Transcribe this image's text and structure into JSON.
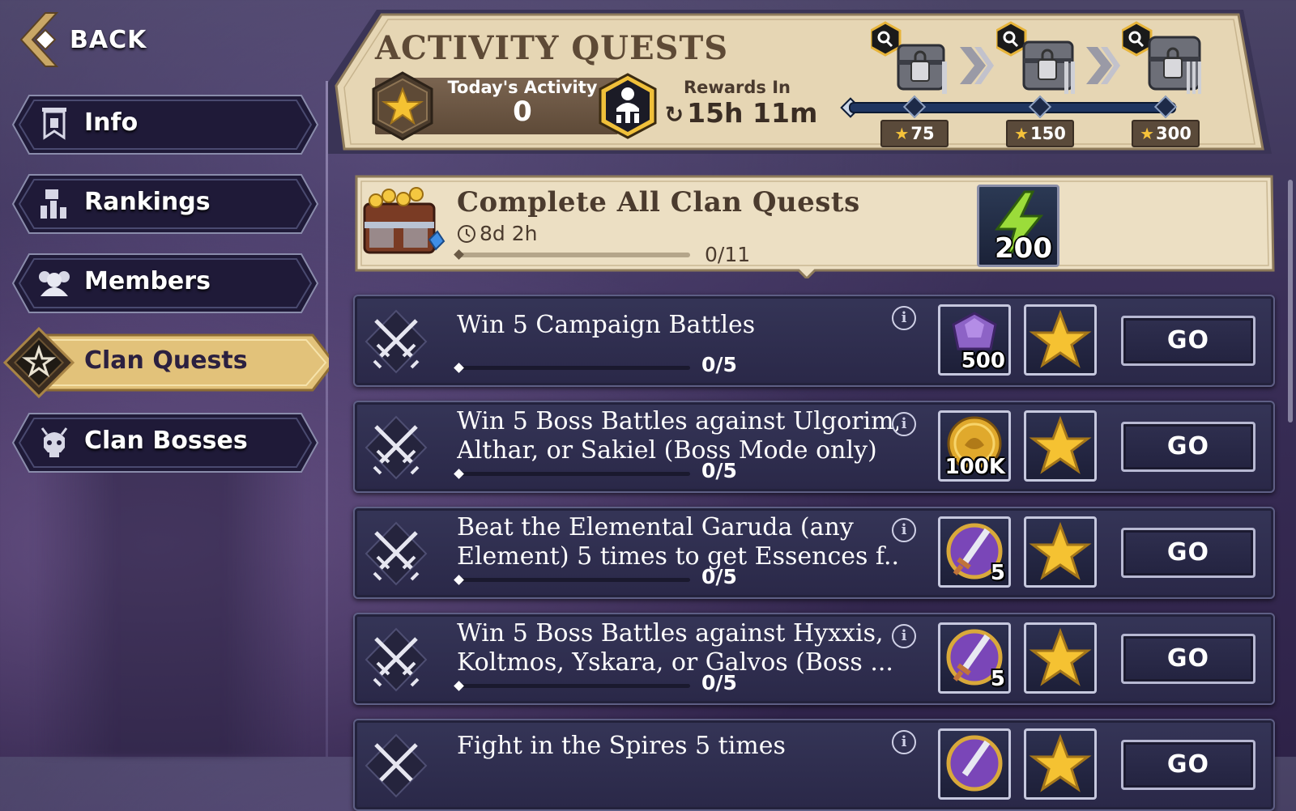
{
  "nav": {
    "back_label": "BACK",
    "items": [
      {
        "label": "Info",
        "icon": "banner-icon",
        "active": false
      },
      {
        "label": "Rankings",
        "icon": "rankings-icon",
        "active": false
      },
      {
        "label": "Members",
        "icon": "members-icon",
        "active": false
      },
      {
        "label": "Clan Quests",
        "icon": "clan-star-icon",
        "active": true
      },
      {
        "label": "Clan Bosses",
        "icon": "skull-icon",
        "active": false
      }
    ]
  },
  "header": {
    "title": "ACTIVITY QUESTS",
    "today_label": "Today's Activity",
    "today_value": "0",
    "rewards_label": "Rewards In",
    "rewards_time": "15h 11m",
    "milestones": [
      "75",
      "150",
      "300"
    ]
  },
  "featured": {
    "title": "Complete All Clan Quests",
    "time": "8d 2h",
    "progress": "0/11",
    "reward_amount": "200",
    "reward_icon": "energy-bolt-icon"
  },
  "quests": [
    {
      "title": "Win 5 Campaign Battles",
      "progress": "0/5",
      "reward_amount": "500",
      "reward_icon": "gem-icon",
      "go": "GO"
    },
    {
      "title": "Win 5 Boss Battles against Ulgorim,",
      "title2": "Althar, or Sakiel (Boss Mode only)",
      "progress": "0/5",
      "reward_amount": "100K",
      "reward_icon": "gold-coin-icon",
      "go": "GO"
    },
    {
      "title": "Beat the Elemental Garuda (any",
      "title2": "Element) 5 times to get Essences f...",
      "progress": "0/5",
      "reward_amount": "5",
      "reward_icon": "sword-token-icon",
      "go": "GO"
    },
    {
      "title": "Win 5 Boss Battles against Hyxxis,",
      "title2": "Koltmos, Yskara, or Galvos (Boss ...",
      "progress": "0/5",
      "reward_amount": "5",
      "reward_icon": "sword-token-icon",
      "go": "GO"
    },
    {
      "title": "Fight in the Spires 5 times",
      "progress": "",
      "reward_amount": "",
      "reward_icon": "sword-token-icon",
      "go": "GO"
    }
  ],
  "colors": {
    "gold_accent": "#e8c46a",
    "panel_dark": "#2a2848",
    "parchment": "#e9dcc0"
  }
}
